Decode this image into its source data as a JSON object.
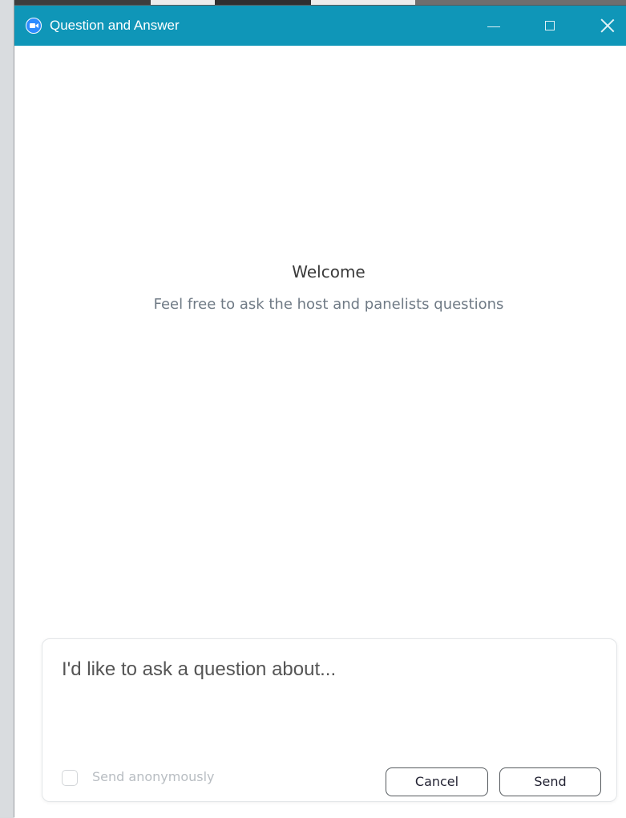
{
  "window": {
    "title": "Question and Answer",
    "accent_color": "#0f96b8",
    "app_icon": "zoom-camera-icon",
    "controls": [
      "minimize-icon",
      "maximize-icon",
      "close-icon"
    ]
  },
  "empty_state": {
    "title": "Welcome",
    "subtitle": "Feel free to ask the host and panelists questions"
  },
  "compose": {
    "placeholder": "I'd like to ask a question about...",
    "value": "",
    "anonymous_label": "Send anonymously",
    "anonymous_checked": false,
    "cancel_label": "Cancel",
    "send_label": "Send"
  }
}
